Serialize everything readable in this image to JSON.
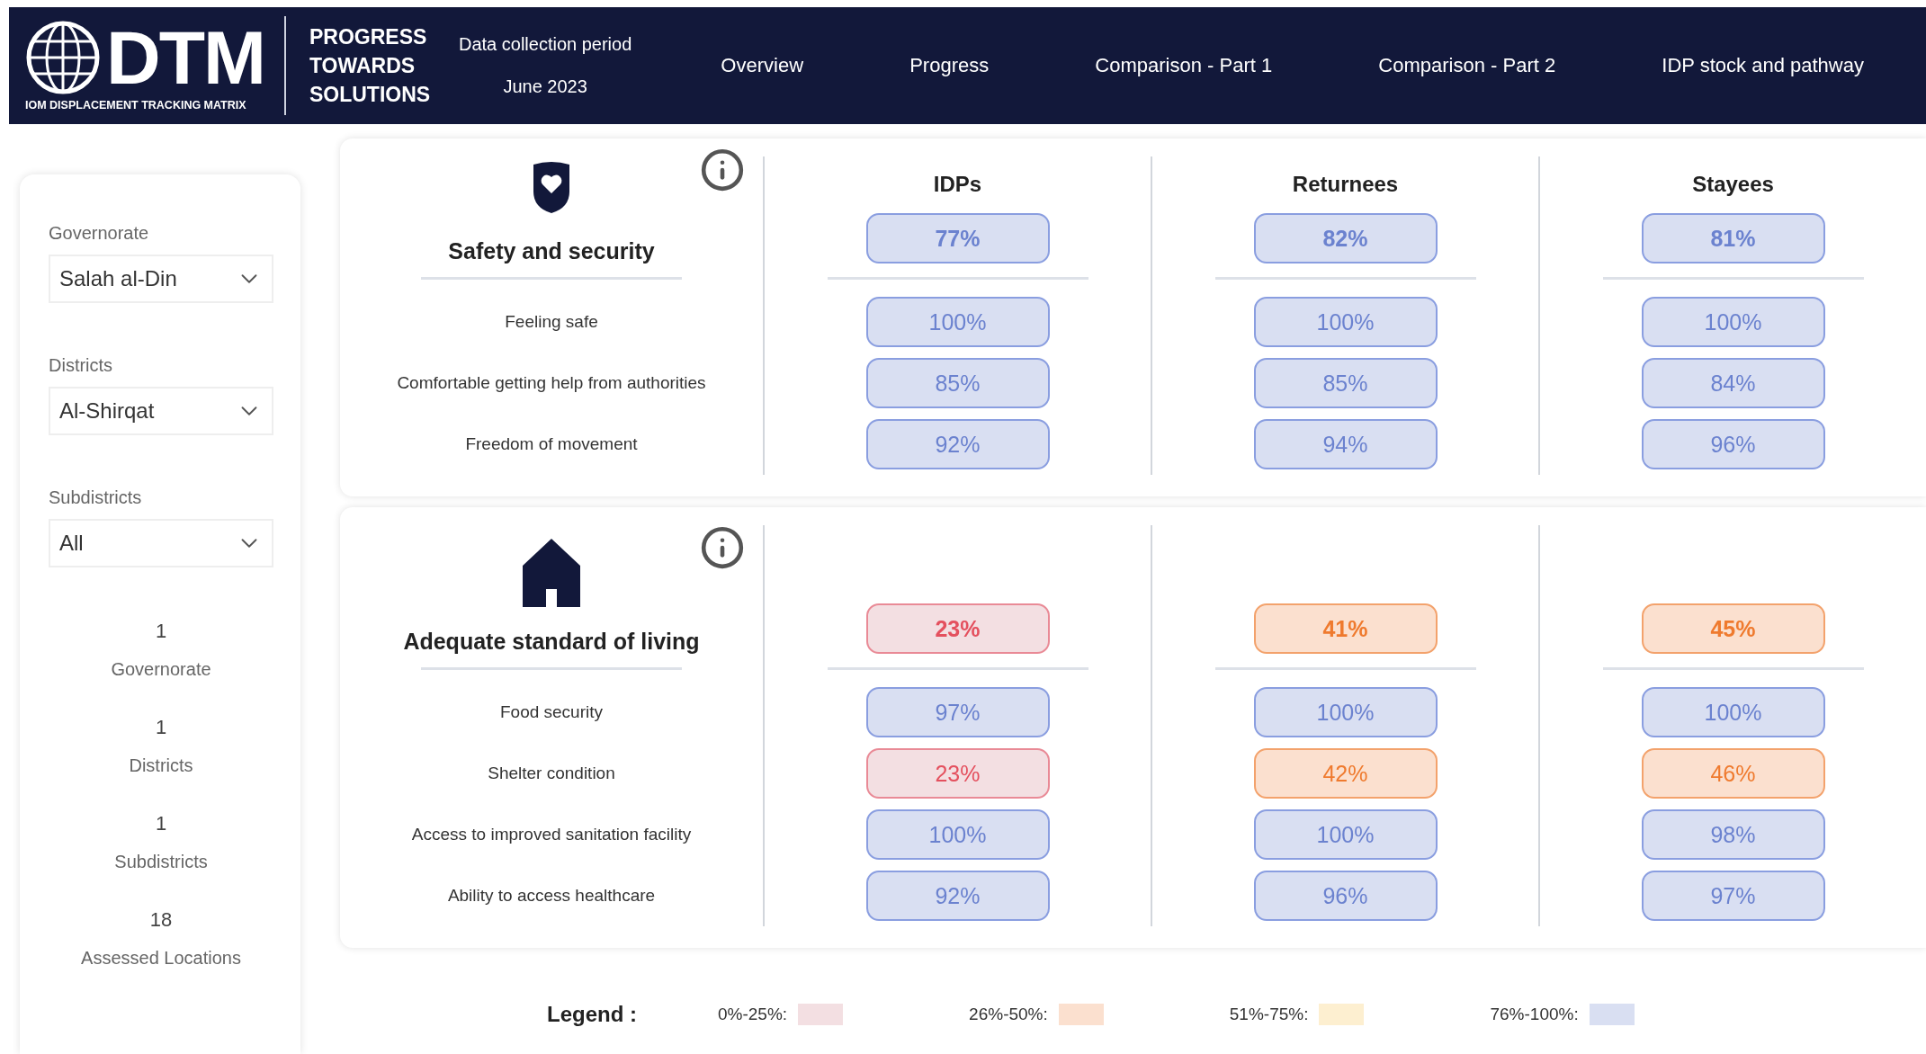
{
  "header": {
    "logo": {
      "wordmark": "DTM",
      "tagline": "IOM DISPLACEMENT TRACKING MATRIX"
    },
    "title": "PROGRESS TOWARDS SOLUTIONS",
    "period_label": "Data collection period",
    "period": "June 2023",
    "nav": [
      "Overview",
      "Progress",
      "Comparison - Part 1",
      "Comparison - Part 2",
      "IDP stock and pathway"
    ]
  },
  "filters": [
    {
      "label": "Governorate",
      "value": "Salah al-Din"
    },
    {
      "label": "Districts",
      "value": "Al-Shirqat"
    },
    {
      "label": "Subdistricts",
      "value": "All"
    }
  ],
  "stats": [
    {
      "value": "1",
      "label": "Governorate"
    },
    {
      "value": "1",
      "label": "Districts"
    },
    {
      "value": "1",
      "label": "Subdistricts"
    },
    {
      "value": "18",
      "label": "Assessed Locations"
    }
  ],
  "sections": [
    {
      "kind": "shield",
      "title": "Safety and security",
      "columns": [
        "IDPs",
        "Returnees",
        "Stayees"
      ],
      "totals": [
        {
          "value": "77%",
          "color": "#d9dff2"
        },
        {
          "value": "82%",
          "color": "#d9dff2"
        },
        {
          "value": "81%",
          "color": "#d9dff2"
        }
      ],
      "indicators": [
        {
          "label": "Feeling safe",
          "values": [
            {
              "value": "100%",
              "color": "#d9dff2"
            },
            {
              "value": "100%",
              "color": "#d9dff2"
            },
            {
              "value": "100%",
              "color": "#d9dff2"
            }
          ]
        },
        {
          "label": "Comfortable getting help from authorities",
          "values": [
            {
              "value": "85%",
              "color": "#d9dff2"
            },
            {
              "value": "85%",
              "color": "#d9dff2"
            },
            {
              "value": "84%",
              "color": "#d9dff2"
            }
          ]
        },
        {
          "label": "Freedom of movement",
          "values": [
            {
              "value": "92%",
              "color": "#d9dff2"
            },
            {
              "value": "94%",
              "color": "#d9dff2"
            },
            {
              "value": "96%",
              "color": "#d9dff2"
            }
          ]
        }
      ]
    },
    {
      "kind": "house",
      "title": "Adequate standard of living",
      "totals": [
        {
          "value": "23%",
          "color": "#f3dfe2"
        },
        {
          "value": "41%",
          "color": "#fbe0cf"
        },
        {
          "value": "45%",
          "color": "#fbe0cf"
        }
      ],
      "indicators": [
        {
          "label": "Food security",
          "values": [
            {
              "value": "97%",
              "color": "#d9dff2"
            },
            {
              "value": "100%",
              "color": "#d9dff2"
            },
            {
              "value": "100%",
              "color": "#d9dff2"
            }
          ]
        },
        {
          "label": "Shelter condition",
          "values": [
            {
              "value": "23%",
              "color": "#f3dfe2"
            },
            {
              "value": "42%",
              "color": "#fbe0cf"
            },
            {
              "value": "46%",
              "color": "#fbe0cf"
            }
          ]
        },
        {
          "label": "Access to improved sanitation facility",
          "values": [
            {
              "value": "100%",
              "color": "#d9dff2"
            },
            {
              "value": "100%",
              "color": "#d9dff2"
            },
            {
              "value": "98%",
              "color": "#d9dff2"
            }
          ]
        },
        {
          "label": "Ability to access healthcare",
          "values": [
            {
              "value": "92%",
              "color": "#d9dff2"
            },
            {
              "value": "96%",
              "color": "#d9dff2"
            },
            {
              "value": "97%",
              "color": "#d9dff2"
            }
          ]
        }
      ]
    }
  ],
  "legend": {
    "title": "Legend :",
    "items": [
      {
        "label": "0%-25%:",
        "color": "#f3dfe2"
      },
      {
        "label": "26%-50%:",
        "color": "#fbe0cf"
      },
      {
        "label": "51%-75%:",
        "color": "#fdefd0"
      },
      {
        "label": "76%-100%:",
        "color": "#d9dff2"
      }
    ]
  }
}
